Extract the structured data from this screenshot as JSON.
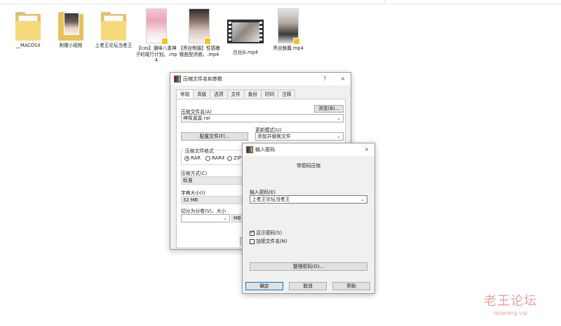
{
  "desktop_files": [
    {
      "label": "__MACOSX",
      "type": "folder"
    },
    {
      "label": "附赠小视频",
      "type": "folder-photo"
    },
    {
      "label": "上老王论坛当老王",
      "type": "folder"
    },
    {
      "label": "【cos】潮味八重神子的尾行计划。.mp4",
      "type": "video"
    },
    {
      "label": "【黑丝制服】性感嫩模曲型诱惑。.mp4",
      "type": "video"
    },
    {
      "label": "白丝jk.mp4",
      "type": "video-film"
    },
    {
      "label": "黑丝魅魔.mp4",
      "type": "video"
    }
  ],
  "archive_dialog": {
    "title": "压缩文件名和参数",
    "help_btn": "?",
    "close_btn": "×",
    "tabs": [
      "常规",
      "高级",
      "选项",
      "文件",
      "备份",
      "时间",
      "注释"
    ],
    "active_tab": "常规",
    "archive_name_label": "压缩文件名(A)",
    "browse_label": "浏览(B)...",
    "archive_name_value": "神探渥渥.rar",
    "update_mode_label": "更新模式(U)",
    "profiles_label": "配置文件(F)...",
    "update_mode_value": "添加并替换文件",
    "format_label": "压缩文件格式",
    "formats": [
      "RAR",
      "RAR4",
      "ZIP"
    ],
    "selected_format": "RAR",
    "method_label": "压缩方式(C)",
    "method_value": "标准",
    "dict_label": "字典大小(I)",
    "dict_value": "32 MB",
    "split_label": "切分为分卷(V)，大小",
    "split_value": "",
    "unit_value": "MB"
  },
  "password_dialog": {
    "title": "输入密码",
    "close_btn": "×",
    "heading": "带密码压缩",
    "enter_label": "输入密码(E)",
    "password_value": "上老王论坛当老王",
    "show_password_label": "显示密码(S)",
    "show_password_checked": true,
    "encrypt_names_label": "加密文件名(N)",
    "encrypt_names_checked": false,
    "organize_btn": "整理密码(O)...",
    "ok_btn": "确定",
    "cancel_btn": "取消",
    "help_btn": "帮助"
  },
  "watermark": {
    "text": "老王论坛",
    "url": "laowang.vip"
  }
}
